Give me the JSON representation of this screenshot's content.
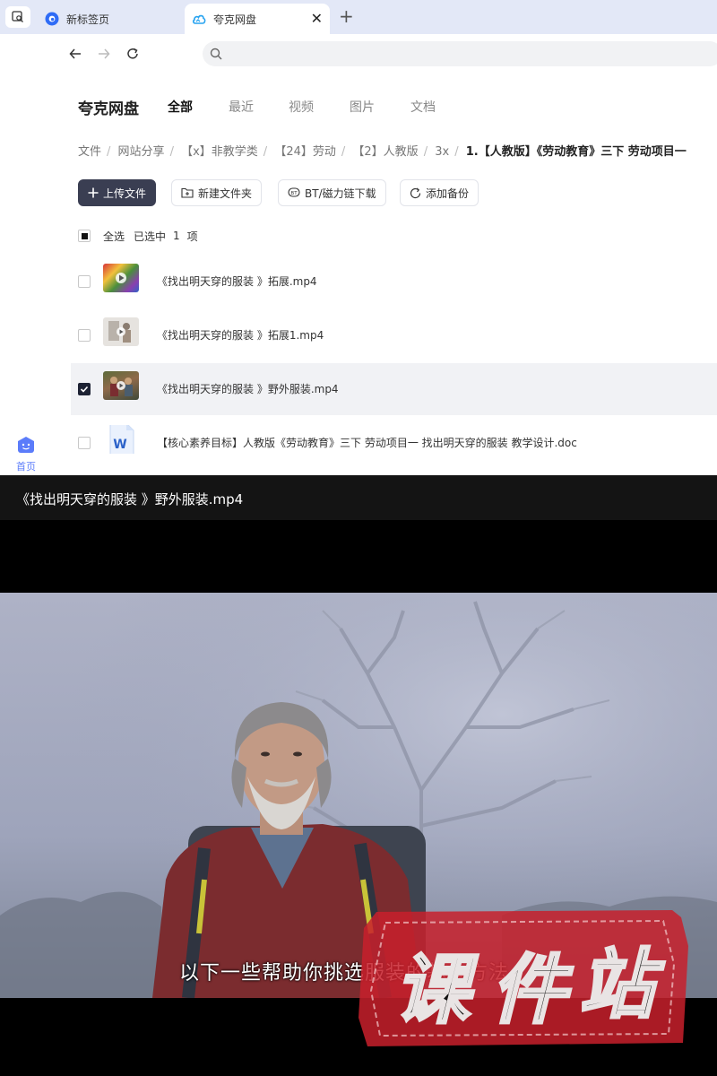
{
  "browser": {
    "tabs": [
      {
        "label": "新标签页",
        "active": false
      },
      {
        "label": "夸克网盘",
        "active": true
      }
    ],
    "address": ""
  },
  "rail": {
    "home_label": "首页"
  },
  "header": {
    "brand": "夸克网盘",
    "nav": [
      "全部",
      "最近",
      "视频",
      "图片",
      "文档"
    ],
    "active_nav": "全部"
  },
  "breadcrumb": [
    "文件",
    "网站分享",
    "【x】非教学类",
    "【24】劳动",
    "【2】人教版",
    "3x",
    "1.【人教版】《劳动教育》三下 劳动项目一"
  ],
  "actions": {
    "upload": "上传文件",
    "new_folder": "新建文件夹",
    "bt_download": "BT/磁力链下载",
    "add_backup": "添加备份"
  },
  "selection": {
    "select_all": "全选",
    "selected_prefix": "已选中",
    "count": "1",
    "unit": "项"
  },
  "files": [
    {
      "name": "《找出明天穿的服装 》拓展.mp4",
      "checked": false
    },
    {
      "name": "《找出明天穿的服装 》拓展1.mp4",
      "checked": false
    },
    {
      "name": "《找出明天穿的服装 》野外服装.mp4",
      "checked": true
    },
    {
      "name": "【核心素养目标】人教版《劳动教育》三下 劳动项目一 找出明天穿的服装  教学设计.doc",
      "checked": false
    }
  ],
  "player": {
    "title": "《找出明天穿的服装 》野外服装.mp4",
    "subtitle": "以下一些帮助你挑选服装的基本方法",
    "watermark": "课件站"
  },
  "colors": {
    "accent": "#3a3e52",
    "brand_blue": "#5b7cfa",
    "tabbar": "#e3e8f7",
    "stamp_red": "#c8202c"
  }
}
